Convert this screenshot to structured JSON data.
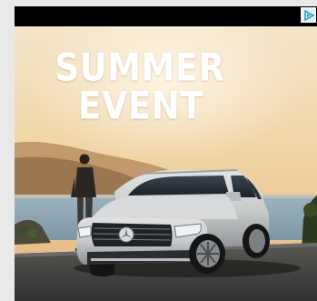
{
  "ad": {
    "headline_line1": "SUMMER",
    "headline_line2": "EVENT",
    "adchoices_icon": "adchoices-triangle-icon",
    "colors": {
      "sky_top": "#f3e2c3",
      "headline": "#ffffff",
      "car": "#c9cacb",
      "adchoices": "#2aa6c9"
    }
  }
}
